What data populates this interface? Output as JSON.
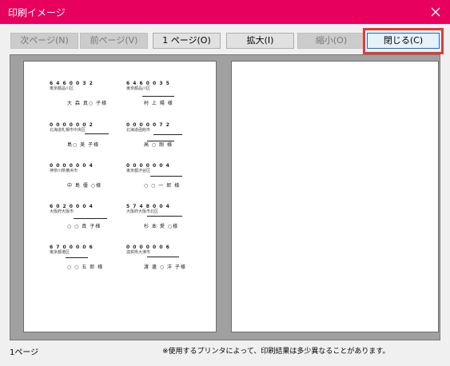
{
  "window": {
    "title": "印刷イメージ"
  },
  "toolbar": {
    "next_page": "次ページ(N)",
    "prev_page": "前ページ(V)",
    "page_indicator": "1 ページ(O)",
    "zoom_in": "拡大(I)",
    "zoom_out": "縮小(O)",
    "close": "閉じる(C)"
  },
  "labels": [
    {
      "zip": "6 4 6 0 0 3 2",
      "addr": "東京都品川区",
      "name": "大 森  真○ 子様"
    },
    {
      "zip": "6 4 6 0 0 3 5",
      "addr": "東京都品川区",
      "name": "村 上  陽 様"
    },
    {
      "zip": "0 0 0 0 0 0 2",
      "addr": "北海道札幌市中央区",
      "name": "島○   美 子様"
    },
    {
      "zip": "0 0 0 0 0 7 2",
      "addr": "北海道函館市",
      "name": "高 ○  剛 様"
    },
    {
      "zip": "0 0 0 0 0 0 4",
      "addr": "神奈川県横浜市",
      "name": "中 島  優 ○様"
    },
    {
      "zip": "0 0 0 0 0 0 4",
      "addr": "東京都渋谷区",
      "name": "○ ○  一 郎 様"
    },
    {
      "zip": "6 0 2 0 0 0 4",
      "addr": "大阪府大阪市",
      "name": "○ ○  真 子様"
    },
    {
      "zip": "5 7 4 8 0 0 4",
      "addr": "大阪府大阪市北区",
      "name": "杉 本  愛 ○様"
    },
    {
      "zip": "6 7 0 0 0 0 6",
      "addr": "東京都港区",
      "name": "○ ○  五 郎 様"
    },
    {
      "zip": "0 0 0 0 0 0 6",
      "addr": "滋賀県大津市",
      "name": "渡 邊 ○  洋 子様"
    }
  ],
  "footer": {
    "page_label": "1ページ",
    "note": "※使用するプリンタによって、印刷結果は多少異なることがあります。"
  }
}
